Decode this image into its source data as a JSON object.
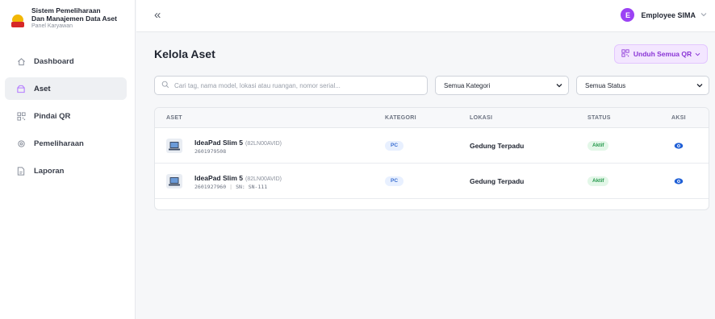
{
  "brand": {
    "line1": "Sistem Pemeliharaan",
    "line2": "Dan Manajemen Data Aset",
    "line3": "Panel Karyawan"
  },
  "sidebar": {
    "items": [
      {
        "label": "Dashboard",
        "icon": "home-icon"
      },
      {
        "label": "Aset",
        "icon": "box-icon",
        "active": true
      },
      {
        "label": "Pindai QR",
        "icon": "qr-icon"
      },
      {
        "label": "Pemeliharaan",
        "icon": "gear-icon"
      },
      {
        "label": "Laporan",
        "icon": "document-icon"
      }
    ]
  },
  "topbar": {
    "collapse_icon": "«",
    "user_initial": "E",
    "user_name": "Employee SIMA"
  },
  "page": {
    "title": "Kelola Aset",
    "qr_button": "Unduh Semua QR"
  },
  "filters": {
    "search_placeholder": "Cari tag, nama model, lokasi atau ruangan, nomor serial...",
    "category_selected": "Semua Kategori",
    "status_selected": "Semua Status"
  },
  "table": {
    "headers": {
      "aset": "ASET",
      "kategori": "KATEGORI",
      "lokasi": "LOKASI",
      "status": "STATUS",
      "aksi": "AKSI"
    },
    "rows": [
      {
        "name": "IdeaPad Slim 5",
        "model": "(82LN00AVID)",
        "tag": "2601979508",
        "serial": "",
        "category": "PC",
        "location": "Gedung Terpadu",
        "status": "Aktif"
      },
      {
        "name": "IdeaPad Slim 5",
        "model": "(82LN00AVID)",
        "tag": "2601927960",
        "serial": "SN: SN-111",
        "category": "PC",
        "location": "Gedung Terpadu",
        "status": "Aktif"
      }
    ]
  },
  "colors": {
    "accent": "#9b42f4",
    "qr_bg": "#f3e6ff",
    "status_green": "#23974a",
    "category_blue": "#3b6fd1",
    "eye_blue": "#1f5fd6"
  }
}
